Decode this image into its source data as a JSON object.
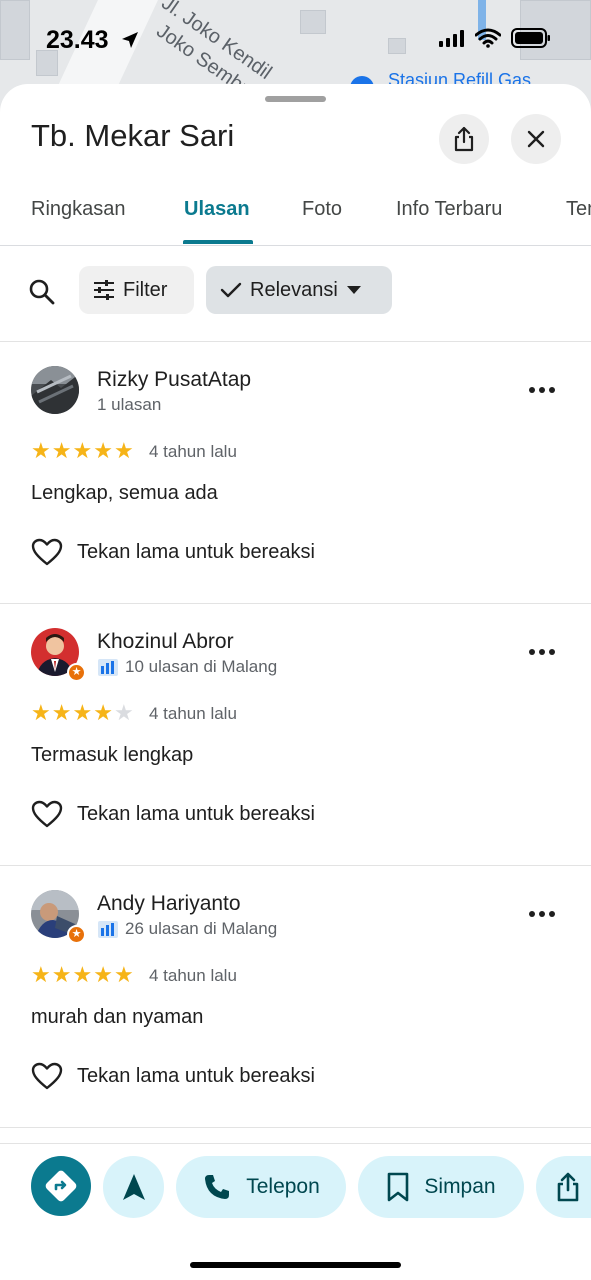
{
  "status": {
    "time": "23.43"
  },
  "map": {
    "street_label": "Jl. Joko Kendil",
    "street_label2": "Joko Sembung",
    "poi_label": "Stasiun Refill Gas"
  },
  "place": {
    "title": "Tb. Mekar Sari"
  },
  "tabs": [
    {
      "label": "Ringkasan"
    },
    {
      "label": "Ulasan"
    },
    {
      "label": "Foto"
    },
    {
      "label": "Info Terbaru"
    },
    {
      "label": "Tentang"
    }
  ],
  "toolbar": {
    "filter_label": "Filter",
    "sort_label": "Relevansi"
  },
  "reviews": [
    {
      "name": "Rizky PusatAtap",
      "meta": "1 ulasan",
      "local_guide": false,
      "rating": 5,
      "time": "4 tahun lalu",
      "text": "Lengkap, semua ada",
      "react_label": "Tekan lama untuk bereaksi"
    },
    {
      "name": "Khozinul Abror",
      "meta": "10 ulasan di Malang",
      "local_guide": true,
      "rating": 4,
      "time": "4 tahun lalu",
      "text": "Termasuk lengkap",
      "react_label": "Tekan lama untuk bereaksi"
    },
    {
      "name": "Andy Hariyanto",
      "meta": "26 ulasan di Malang",
      "local_guide": true,
      "rating": 5,
      "time": "4 tahun lalu",
      "text": "murah dan nyaman",
      "react_label": "Tekan lama untuk bereaksi"
    }
  ],
  "bottom_bar": {
    "call_label": "Telepon",
    "save_label": "Simpan"
  },
  "colors": {
    "accent": "#0b7a8f",
    "star": "#f6b418",
    "chip_bg": "#d8f3fa",
    "directions_bg": "#0b7a8f"
  }
}
